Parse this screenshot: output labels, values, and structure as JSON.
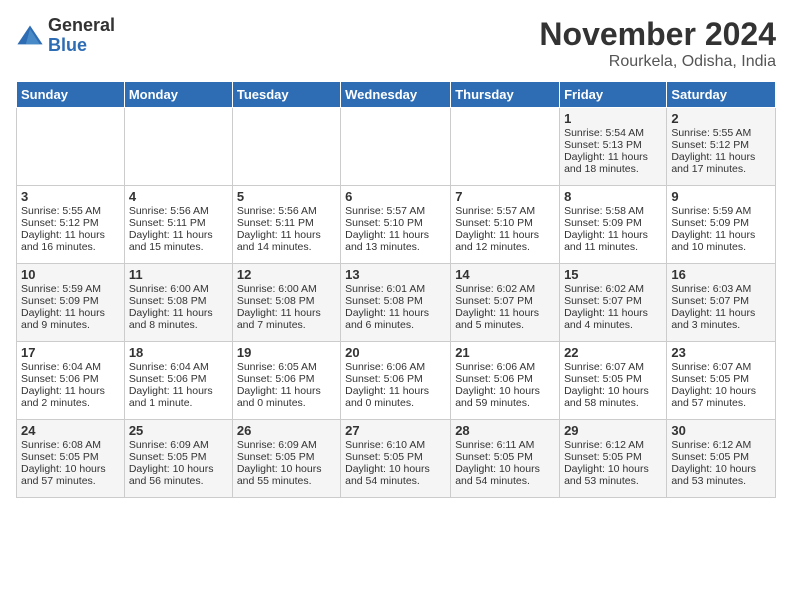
{
  "header": {
    "logo_general": "General",
    "logo_blue": "Blue",
    "title": "November 2024",
    "location": "Rourkela, Odisha, India"
  },
  "weekdays": [
    "Sunday",
    "Monday",
    "Tuesday",
    "Wednesday",
    "Thursday",
    "Friday",
    "Saturday"
  ],
  "weeks": [
    [
      {
        "day": "",
        "info": ""
      },
      {
        "day": "",
        "info": ""
      },
      {
        "day": "",
        "info": ""
      },
      {
        "day": "",
        "info": ""
      },
      {
        "day": "",
        "info": ""
      },
      {
        "day": "1",
        "info": "Sunrise: 5:54 AM\nSunset: 5:13 PM\nDaylight: 11 hours and 18 minutes."
      },
      {
        "day": "2",
        "info": "Sunrise: 5:55 AM\nSunset: 5:12 PM\nDaylight: 11 hours and 17 minutes."
      }
    ],
    [
      {
        "day": "3",
        "info": "Sunrise: 5:55 AM\nSunset: 5:12 PM\nDaylight: 11 hours and 16 minutes."
      },
      {
        "day": "4",
        "info": "Sunrise: 5:56 AM\nSunset: 5:11 PM\nDaylight: 11 hours and 15 minutes."
      },
      {
        "day": "5",
        "info": "Sunrise: 5:56 AM\nSunset: 5:11 PM\nDaylight: 11 hours and 14 minutes."
      },
      {
        "day": "6",
        "info": "Sunrise: 5:57 AM\nSunset: 5:10 PM\nDaylight: 11 hours and 13 minutes."
      },
      {
        "day": "7",
        "info": "Sunrise: 5:57 AM\nSunset: 5:10 PM\nDaylight: 11 hours and 12 minutes."
      },
      {
        "day": "8",
        "info": "Sunrise: 5:58 AM\nSunset: 5:09 PM\nDaylight: 11 hours and 11 minutes."
      },
      {
        "day": "9",
        "info": "Sunrise: 5:59 AM\nSunset: 5:09 PM\nDaylight: 11 hours and 10 minutes."
      }
    ],
    [
      {
        "day": "10",
        "info": "Sunrise: 5:59 AM\nSunset: 5:09 PM\nDaylight: 11 hours and 9 minutes."
      },
      {
        "day": "11",
        "info": "Sunrise: 6:00 AM\nSunset: 5:08 PM\nDaylight: 11 hours and 8 minutes."
      },
      {
        "day": "12",
        "info": "Sunrise: 6:00 AM\nSunset: 5:08 PM\nDaylight: 11 hours and 7 minutes."
      },
      {
        "day": "13",
        "info": "Sunrise: 6:01 AM\nSunset: 5:08 PM\nDaylight: 11 hours and 6 minutes."
      },
      {
        "day": "14",
        "info": "Sunrise: 6:02 AM\nSunset: 5:07 PM\nDaylight: 11 hours and 5 minutes."
      },
      {
        "day": "15",
        "info": "Sunrise: 6:02 AM\nSunset: 5:07 PM\nDaylight: 11 hours and 4 minutes."
      },
      {
        "day": "16",
        "info": "Sunrise: 6:03 AM\nSunset: 5:07 PM\nDaylight: 11 hours and 3 minutes."
      }
    ],
    [
      {
        "day": "17",
        "info": "Sunrise: 6:04 AM\nSunset: 5:06 PM\nDaylight: 11 hours and 2 minutes."
      },
      {
        "day": "18",
        "info": "Sunrise: 6:04 AM\nSunset: 5:06 PM\nDaylight: 11 hours and 1 minute."
      },
      {
        "day": "19",
        "info": "Sunrise: 6:05 AM\nSunset: 5:06 PM\nDaylight: 11 hours and 0 minutes."
      },
      {
        "day": "20",
        "info": "Sunrise: 6:06 AM\nSunset: 5:06 PM\nDaylight: 11 hours and 0 minutes."
      },
      {
        "day": "21",
        "info": "Sunrise: 6:06 AM\nSunset: 5:06 PM\nDaylight: 10 hours and 59 minutes."
      },
      {
        "day": "22",
        "info": "Sunrise: 6:07 AM\nSunset: 5:05 PM\nDaylight: 10 hours and 58 minutes."
      },
      {
        "day": "23",
        "info": "Sunrise: 6:07 AM\nSunset: 5:05 PM\nDaylight: 10 hours and 57 minutes."
      }
    ],
    [
      {
        "day": "24",
        "info": "Sunrise: 6:08 AM\nSunset: 5:05 PM\nDaylight: 10 hours and 57 minutes."
      },
      {
        "day": "25",
        "info": "Sunrise: 6:09 AM\nSunset: 5:05 PM\nDaylight: 10 hours and 56 minutes."
      },
      {
        "day": "26",
        "info": "Sunrise: 6:09 AM\nSunset: 5:05 PM\nDaylight: 10 hours and 55 minutes."
      },
      {
        "day": "27",
        "info": "Sunrise: 6:10 AM\nSunset: 5:05 PM\nDaylight: 10 hours and 54 minutes."
      },
      {
        "day": "28",
        "info": "Sunrise: 6:11 AM\nSunset: 5:05 PM\nDaylight: 10 hours and 54 minutes."
      },
      {
        "day": "29",
        "info": "Sunrise: 6:12 AM\nSunset: 5:05 PM\nDaylight: 10 hours and 53 minutes."
      },
      {
        "day": "30",
        "info": "Sunrise: 6:12 AM\nSunset: 5:05 PM\nDaylight: 10 hours and 53 minutes."
      }
    ]
  ]
}
